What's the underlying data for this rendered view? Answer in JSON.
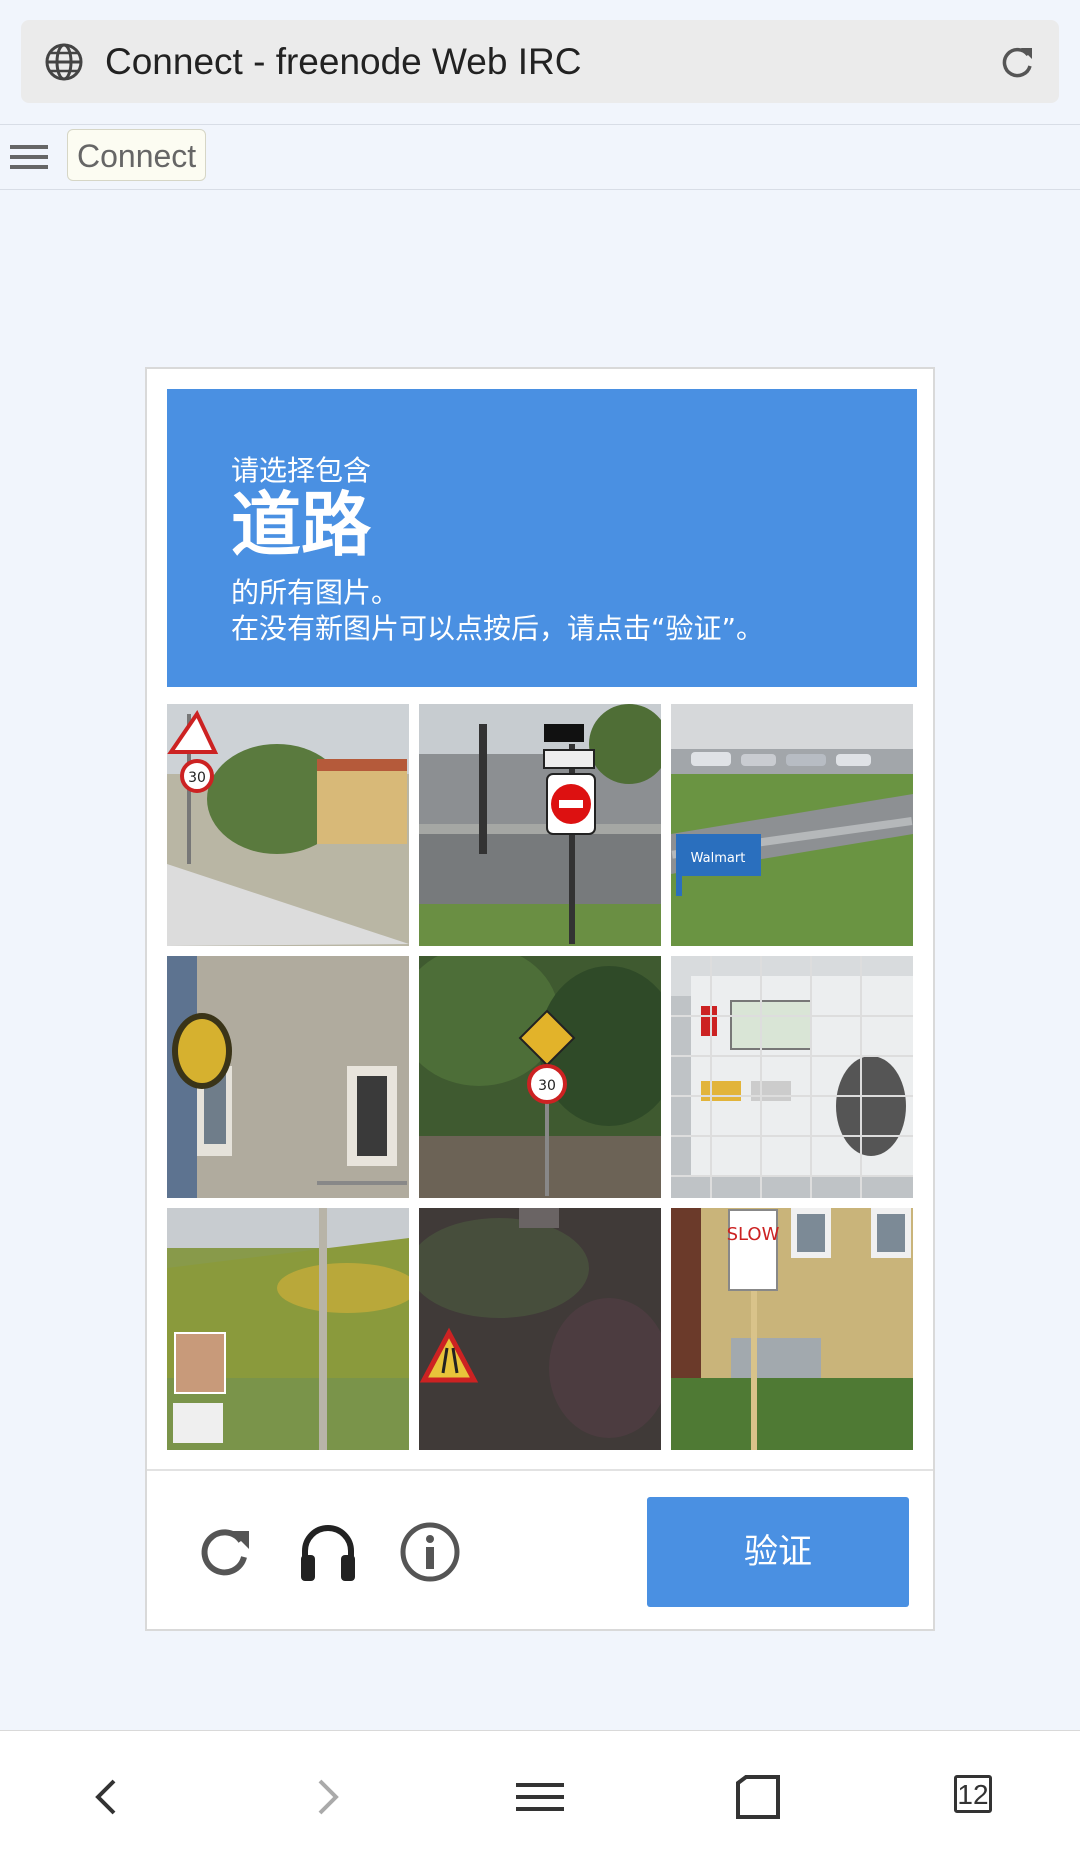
{
  "browser": {
    "page_title": "Connect - freenode Web IRC",
    "tab_count": "12"
  },
  "toolbar": {
    "connect_label": "Connect"
  },
  "captcha": {
    "instruction_line1": "请选择包含",
    "keyword": "道路",
    "instruction_line3": "的所有图片。",
    "instruction_line4": "在没有新图片可以点按后，请点击“验证”。",
    "verify_label": "验证",
    "tiles": [
      {
        "label": "road with warning and speed 30 signs"
      },
      {
        "label": "street intersection with do not enter sign"
      },
      {
        "label": "parking lot with Walmart sign"
      },
      {
        "label": "building wall with round sign"
      },
      {
        "label": "bushes with school crossing and 30 sign"
      },
      {
        "label": "white truck behind fence"
      },
      {
        "label": "grassy hill with pole and signs"
      },
      {
        "label": "dark foliage with warning sign"
      },
      {
        "label": "building with SLOW sign"
      }
    ],
    "colors": {
      "header": "#4a90e2",
      "button": "#4a90e2"
    }
  },
  "icons": {
    "globe": "globe-icon",
    "reload": "reload-icon",
    "menu": "hamburger-menu-icon",
    "captcha_reload": "refresh-icon",
    "audio": "headphones-icon",
    "info": "info-icon",
    "back": "chevron-left-icon",
    "forward": "chevron-right-icon",
    "nav_menu": "menu-icon",
    "home": "home-square-icon",
    "tabs": "tabs-icon"
  }
}
